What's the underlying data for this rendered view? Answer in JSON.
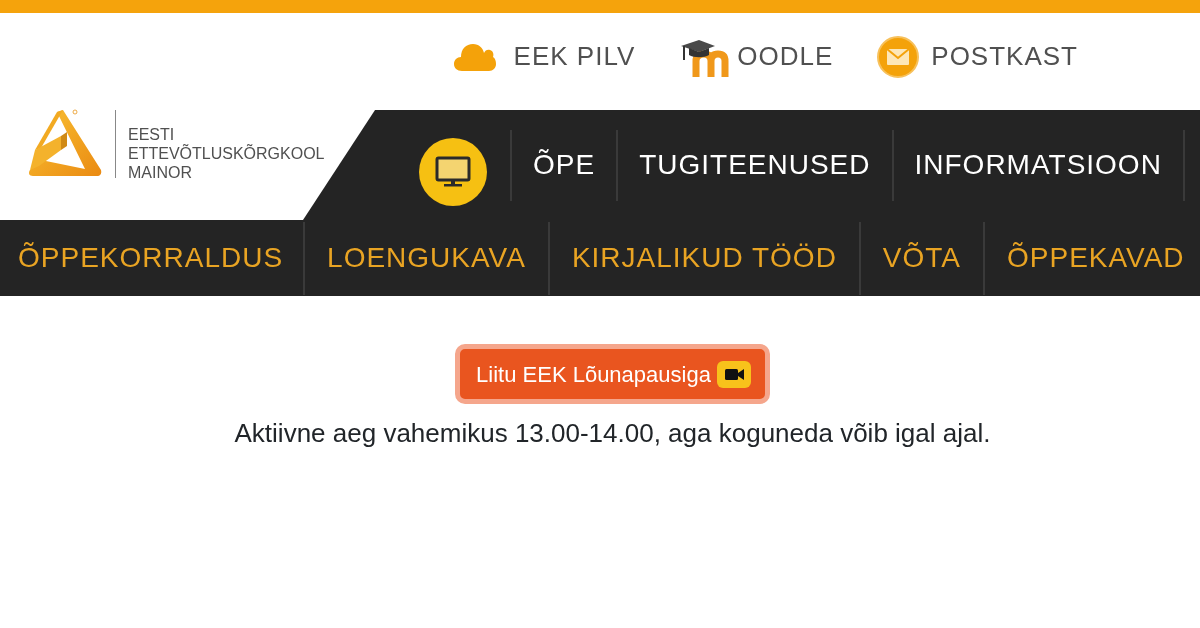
{
  "top_links": [
    {
      "kind": "cloud",
      "label": "EEK PILV"
    },
    {
      "kind": "moodle",
      "label": "OODLE"
    },
    {
      "kind": "mail",
      "label": "POSTKAST"
    }
  ],
  "logo": {
    "lines": [
      "EESTI",
      "ETTEVÕTLUSKÕRGKOOL",
      "MAINOR"
    ]
  },
  "main_nav": {
    "items": [
      "ÕPE",
      "TUGITEENUSED",
      "INFORMATSIOON"
    ]
  },
  "sub_nav": {
    "items": [
      "ÕPPEKORRALDUS",
      "LOENGUKAVA",
      "KIRJALIKUD TÖÖD",
      "VÕTA",
      "ÕPPEKAVAD"
    ]
  },
  "join_button": {
    "label": "Liitu EEK Lõunapausiga"
  },
  "note": "Aktiivne aeg vahemikus 13.00-14.00, aga koguneda võib igal ajal."
}
